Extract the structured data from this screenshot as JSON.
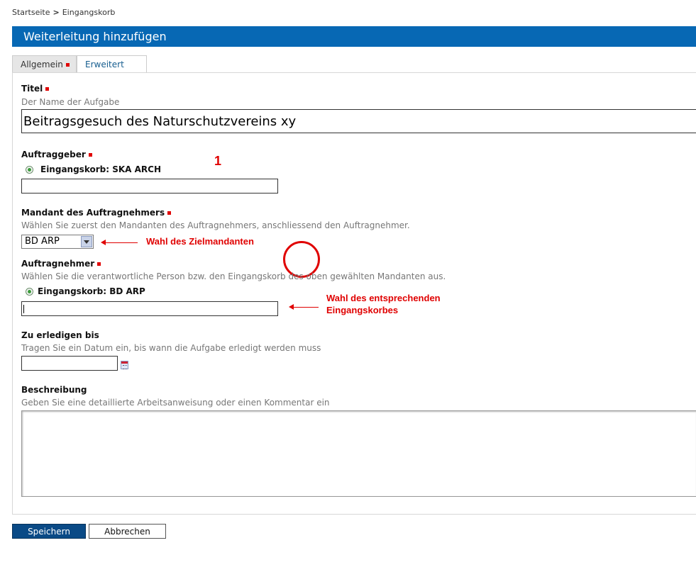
{
  "breadcrumb": {
    "home": "Startseite",
    "separator": ">",
    "current": "Eingangskorb"
  },
  "page": {
    "title": "Weiterleitung hinzufügen"
  },
  "tabs": [
    {
      "label": "Allgemein",
      "active": true,
      "required": true
    },
    {
      "label": "Erweitert",
      "active": false,
      "required": false
    }
  ],
  "form": {
    "titel": {
      "label": "Titel",
      "hint": "Der Name der Aufgabe",
      "value": "Beitragsgesuch des Naturschutzvereins xy"
    },
    "auftraggeber": {
      "label": "Auftraggeber",
      "radio_label": "Eingangskorb: SKA ARCH",
      "input_value": ""
    },
    "mandant": {
      "label": "Mandant des Auftragnehmers",
      "hint": "Wählen Sie zuerst den Mandanten des Auftragnehmers, anschliessend den Auftragnehmer.",
      "selected": "BD ARP"
    },
    "auftragnehmer": {
      "label": "Auftragnehmer",
      "hint": "Wählen Sie die verantwortliche Person bzw. den Eingangskorb des oben gewählten Mandanten aus.",
      "radio_label": "Eingangskorb: BD ARP",
      "input_value": ""
    },
    "erledigen": {
      "label": "Zu erledigen bis",
      "hint": "Tragen Sie ein Datum ein, bis wann die Aufgabe erledigt werden muss",
      "value": ""
    },
    "beschreibung": {
      "label": "Beschreibung",
      "hint": "Geben Sie eine detaillierte Arbeitsanweisung oder einen Kommentar ein",
      "value": ""
    }
  },
  "annotations": {
    "step_number": "1",
    "zielmandant": "Wahl des Zielmandanten",
    "eingangskorb_line1": "Wahl des entsprechenden",
    "eingangskorb_line2": "Eingangskorbes",
    "color": "#e00000"
  },
  "buttons": {
    "save": "Speichern",
    "cancel": "Abbrechen"
  },
  "colors": {
    "title_bar": "#0768b4",
    "required_marker": "#e00000",
    "save_button": "#0a4a86"
  }
}
